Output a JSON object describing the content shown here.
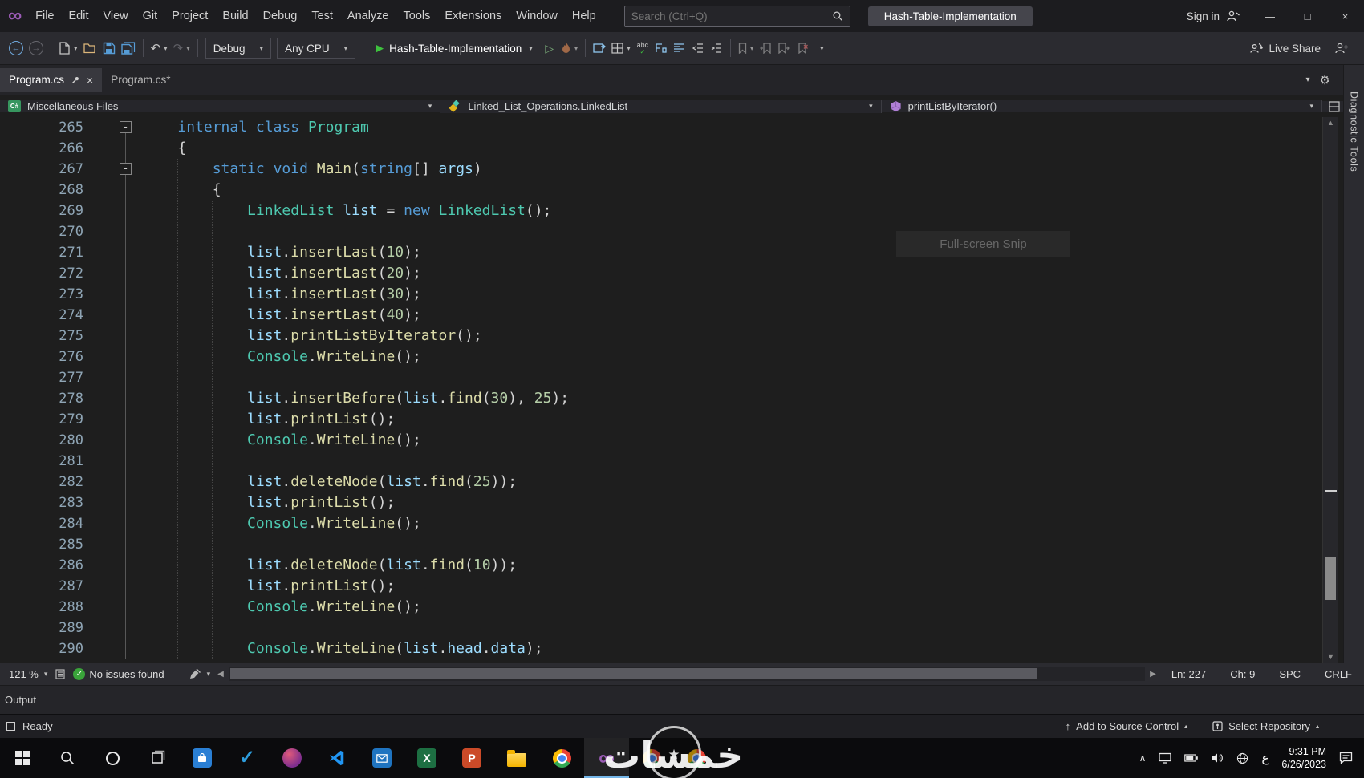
{
  "colors": {
    "tokens": {
      "kw": "#569cd6",
      "ty": "#4ec9b0",
      "me": "#dcdcaa",
      "va": "#9cdcfe",
      "nu": "#b5cea8",
      "pl": "#d4d4d4"
    },
    "start_green": "#3ec13e",
    "vs_purple": "#9a5bb5"
  },
  "titlebar": {
    "menus": [
      "File",
      "Edit",
      "View",
      "Git",
      "Project",
      "Build",
      "Debug",
      "Test",
      "Analyze",
      "Tools",
      "Extensions",
      "Window",
      "Help"
    ],
    "search_placeholder": "Search (Ctrl+Q)",
    "solution": "Hash-Table-Implementation",
    "sign_in": "Sign in"
  },
  "toolbar": {
    "configuration": "Debug",
    "platform": "Any CPU",
    "start_target": "Hash-Table-Implementation",
    "live_share": "Live Share"
  },
  "tabs": [
    {
      "label": "Program.cs",
      "active": true
    },
    {
      "label": "Program.cs*",
      "active": false
    }
  ],
  "navbar": {
    "project": "Miscellaneous Files",
    "type": "Linked_List_Operations.LinkedList",
    "member": "printListByIterator()"
  },
  "editor": {
    "snip_overlay": "Full-screen Snip",
    "lines": [
      {
        "n": 265,
        "fold": true,
        "t": [
          [
            "pl",
            "    "
          ],
          [
            "kw",
            "internal"
          ],
          [
            "pl",
            " "
          ],
          [
            "kw",
            "class"
          ],
          [
            "pl",
            " "
          ],
          [
            "ty",
            "Program"
          ]
        ]
      },
      {
        "n": 266,
        "t": [
          [
            "pl",
            "    {"
          ]
        ]
      },
      {
        "n": 267,
        "fold": true,
        "t": [
          [
            "pl",
            "        "
          ],
          [
            "kw",
            "static"
          ],
          [
            "pl",
            " "
          ],
          [
            "kw",
            "void"
          ],
          [
            "pl",
            " "
          ],
          [
            "me",
            "Main"
          ],
          [
            "pl",
            "("
          ],
          [
            "kw",
            "string"
          ],
          [
            "pl",
            "[] "
          ],
          [
            "va",
            "args"
          ],
          [
            "pl",
            ")"
          ]
        ]
      },
      {
        "n": 268,
        "t": [
          [
            "pl",
            "        {"
          ]
        ]
      },
      {
        "n": 269,
        "t": [
          [
            "pl",
            "            "
          ],
          [
            "ty",
            "LinkedList"
          ],
          [
            "pl",
            " "
          ],
          [
            "va",
            "list"
          ],
          [
            "pl",
            " = "
          ],
          [
            "kw",
            "new"
          ],
          [
            "pl",
            " "
          ],
          [
            "ty",
            "LinkedList"
          ],
          [
            "pl",
            "();"
          ]
        ]
      },
      {
        "n": 270,
        "t": []
      },
      {
        "n": 271,
        "t": [
          [
            "pl",
            "            "
          ],
          [
            "va",
            "list"
          ],
          [
            "pl",
            "."
          ],
          [
            "me",
            "insertLast"
          ],
          [
            "pl",
            "("
          ],
          [
            "nu",
            "10"
          ],
          [
            "pl",
            ");"
          ]
        ]
      },
      {
        "n": 272,
        "t": [
          [
            "pl",
            "            "
          ],
          [
            "va",
            "list"
          ],
          [
            "pl",
            "."
          ],
          [
            "me",
            "insertLast"
          ],
          [
            "pl",
            "("
          ],
          [
            "nu",
            "20"
          ],
          [
            "pl",
            ");"
          ]
        ]
      },
      {
        "n": 273,
        "t": [
          [
            "pl",
            "            "
          ],
          [
            "va",
            "list"
          ],
          [
            "pl",
            "."
          ],
          [
            "me",
            "insertLast"
          ],
          [
            "pl",
            "("
          ],
          [
            "nu",
            "30"
          ],
          [
            "pl",
            ");"
          ]
        ]
      },
      {
        "n": 274,
        "t": [
          [
            "pl",
            "            "
          ],
          [
            "va",
            "list"
          ],
          [
            "pl",
            "."
          ],
          [
            "me",
            "insertLast"
          ],
          [
            "pl",
            "("
          ],
          [
            "nu",
            "40"
          ],
          [
            "pl",
            ");"
          ]
        ]
      },
      {
        "n": 275,
        "t": [
          [
            "pl",
            "            "
          ],
          [
            "va",
            "list"
          ],
          [
            "pl",
            "."
          ],
          [
            "me",
            "printListByIterator"
          ],
          [
            "pl",
            "();"
          ]
        ]
      },
      {
        "n": 276,
        "t": [
          [
            "pl",
            "            "
          ],
          [
            "ty",
            "Console"
          ],
          [
            "pl",
            "."
          ],
          [
            "me",
            "WriteLine"
          ],
          [
            "pl",
            "();"
          ]
        ]
      },
      {
        "n": 277,
        "t": []
      },
      {
        "n": 278,
        "t": [
          [
            "pl",
            "            "
          ],
          [
            "va",
            "list"
          ],
          [
            "pl",
            "."
          ],
          [
            "me",
            "insertBefore"
          ],
          [
            "pl",
            "("
          ],
          [
            "va",
            "list"
          ],
          [
            "pl",
            "."
          ],
          [
            "me",
            "find"
          ],
          [
            "pl",
            "("
          ],
          [
            "nu",
            "30"
          ],
          [
            "pl",
            "), "
          ],
          [
            "nu",
            "25"
          ],
          [
            "pl",
            ");"
          ]
        ]
      },
      {
        "n": 279,
        "t": [
          [
            "pl",
            "            "
          ],
          [
            "va",
            "list"
          ],
          [
            "pl",
            "."
          ],
          [
            "me",
            "printList"
          ],
          [
            "pl",
            "();"
          ]
        ]
      },
      {
        "n": 280,
        "t": [
          [
            "pl",
            "            "
          ],
          [
            "ty",
            "Console"
          ],
          [
            "pl",
            "."
          ],
          [
            "me",
            "WriteLine"
          ],
          [
            "pl",
            "();"
          ]
        ]
      },
      {
        "n": 281,
        "t": []
      },
      {
        "n": 282,
        "t": [
          [
            "pl",
            "            "
          ],
          [
            "va",
            "list"
          ],
          [
            "pl",
            "."
          ],
          [
            "me",
            "deleteNode"
          ],
          [
            "pl",
            "("
          ],
          [
            "va",
            "list"
          ],
          [
            "pl",
            "."
          ],
          [
            "me",
            "find"
          ],
          [
            "pl",
            "("
          ],
          [
            "nu",
            "25"
          ],
          [
            "pl",
            "));"
          ]
        ]
      },
      {
        "n": 283,
        "t": [
          [
            "pl",
            "            "
          ],
          [
            "va",
            "list"
          ],
          [
            "pl",
            "."
          ],
          [
            "me",
            "printList"
          ],
          [
            "pl",
            "();"
          ]
        ]
      },
      {
        "n": 284,
        "t": [
          [
            "pl",
            "            "
          ],
          [
            "ty",
            "Console"
          ],
          [
            "pl",
            "."
          ],
          [
            "me",
            "WriteLine"
          ],
          [
            "pl",
            "();"
          ]
        ]
      },
      {
        "n": 285,
        "t": []
      },
      {
        "n": 286,
        "t": [
          [
            "pl",
            "            "
          ],
          [
            "va",
            "list"
          ],
          [
            "pl",
            "."
          ],
          [
            "me",
            "deleteNode"
          ],
          [
            "pl",
            "("
          ],
          [
            "va",
            "list"
          ],
          [
            "pl",
            "."
          ],
          [
            "me",
            "find"
          ],
          [
            "pl",
            "("
          ],
          [
            "nu",
            "10"
          ],
          [
            "pl",
            "));"
          ]
        ]
      },
      {
        "n": 287,
        "t": [
          [
            "pl",
            "            "
          ],
          [
            "va",
            "list"
          ],
          [
            "pl",
            "."
          ],
          [
            "me",
            "printList"
          ],
          [
            "pl",
            "();"
          ]
        ]
      },
      {
        "n": 288,
        "t": [
          [
            "pl",
            "            "
          ],
          [
            "ty",
            "Console"
          ],
          [
            "pl",
            "."
          ],
          [
            "me",
            "WriteLine"
          ],
          [
            "pl",
            "();"
          ]
        ]
      },
      {
        "n": 289,
        "t": []
      },
      {
        "n": 290,
        "t": [
          [
            "pl",
            "            "
          ],
          [
            "ty",
            "Console"
          ],
          [
            "pl",
            "."
          ],
          [
            "me",
            "WriteLine"
          ],
          [
            "pl",
            "("
          ],
          [
            "va",
            "list"
          ],
          [
            "pl",
            "."
          ],
          [
            "va",
            "head"
          ],
          [
            "pl",
            "."
          ],
          [
            "va",
            "data"
          ],
          [
            "pl",
            ");"
          ]
        ]
      }
    ]
  },
  "editor_bar": {
    "zoom": "121 %",
    "issues": "No issues found",
    "line": "Ln: 227",
    "column": "Ch: 9",
    "whitespace": "SPC",
    "line_ending": "CRLF"
  },
  "output_panel": {
    "title": "Output"
  },
  "statusbar": {
    "message": "Ready",
    "add_to_source_control": "Add to Source Control",
    "select_repository": "Select Repository"
  },
  "right_strip": {
    "label": "Diagnostic Tools"
  },
  "taskbar": {
    "items": [
      {
        "id": "start",
        "kind": "start"
      },
      {
        "id": "search",
        "kind": "search"
      },
      {
        "id": "cortana",
        "kind": "ring"
      },
      {
        "id": "task-view",
        "kind": "taskview"
      },
      {
        "id": "store-app",
        "kind": "tile-store"
      },
      {
        "id": "todo-app",
        "kind": "check"
      },
      {
        "id": "photos-app",
        "kind": "sphere"
      },
      {
        "id": "vscode",
        "kind": "vscode"
      },
      {
        "id": "mail-app",
        "kind": "mail"
      },
      {
        "id": "excel",
        "kind": "excel"
      },
      {
        "id": "powerpoint",
        "kind": "ppt"
      },
      {
        "id": "file-explorer",
        "kind": "folder"
      },
      {
        "id": "chrome",
        "kind": "chrome"
      },
      {
        "id": "visual-studio",
        "kind": "vs",
        "active": true
      },
      {
        "id": "browser-2",
        "kind": "chrome"
      },
      {
        "id": "browser-3",
        "kind": "chrome"
      }
    ],
    "tray": [
      {
        "id": "hidden-icons",
        "kind": "chevron"
      },
      {
        "id": "display",
        "kind": "monitor"
      },
      {
        "id": "battery",
        "kind": "battery"
      },
      {
        "id": "speaker",
        "kind": "speaker"
      },
      {
        "id": "network",
        "kind": "globe"
      }
    ],
    "language": "ع",
    "clock_time": "9:31 PM",
    "clock_date": "6/26/2023"
  },
  "watermark": {
    "text": "خمسات"
  }
}
